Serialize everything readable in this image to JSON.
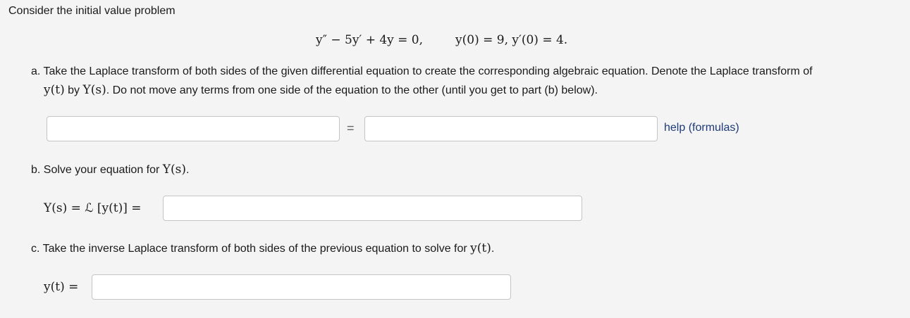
{
  "intro": "Consider the initial value problem",
  "equation": {
    "ode": "y″ − 5y′ + 4y = 0,",
    "conditions": "y(0) = 9,  y′(0) = 4."
  },
  "part_a": {
    "line1": "a. Take the Laplace transform of both sides of the given differential equation to create the corresponding algebraic equation. Denote the Laplace transform of",
    "line2_a": "y(t)",
    "line2_b": " by ",
    "line2_c": "Y(s)",
    "line2_d": ". Do not move any terms from one side of the equation to the other (until you get to part (b) below).",
    "lhs_value": "",
    "equals": "=",
    "rhs_value": "",
    "help_link": "help (formulas)"
  },
  "part_b": {
    "text_a": "b. Solve your equation for ",
    "text_b": "Y(s)",
    "text_c": ".",
    "label": "Y(s) = ℒ [y(t)] =",
    "value": ""
  },
  "part_c": {
    "text_a": "c. Take the inverse Laplace transform of both sides of the previous equation to solve for ",
    "text_b": "y(t)",
    "text_c": ".",
    "label": "y(t) =",
    "value": ""
  }
}
